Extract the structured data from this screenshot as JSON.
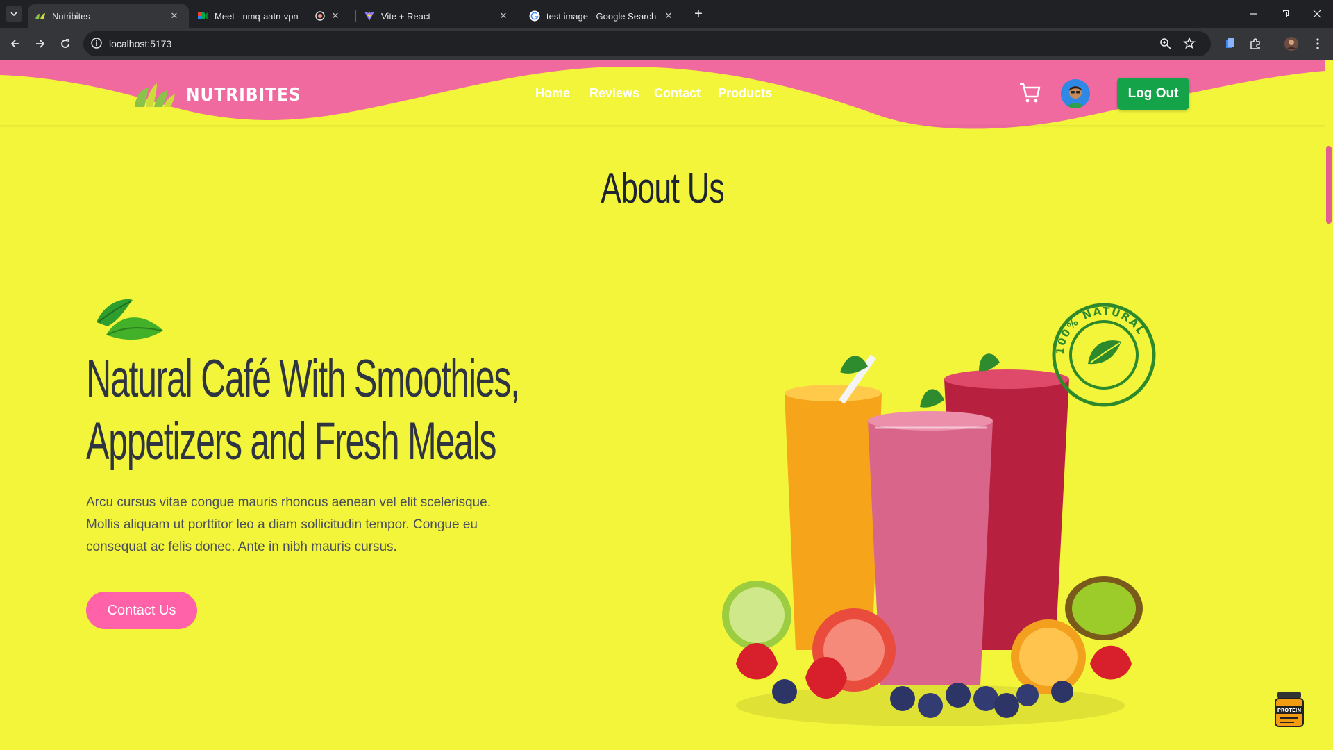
{
  "browser": {
    "tabs": [
      {
        "title": "Nutribites",
        "active": true
      },
      {
        "title": "Meet - nmq-aatn-vpn",
        "active": false
      },
      {
        "title": "Vite + React",
        "active": false
      },
      {
        "title": "test image - Google Search",
        "active": false
      }
    ],
    "url": "localhost:5173"
  },
  "nav": {
    "logo_text": "NUTRIBITES",
    "links": [
      "Home",
      "Reviews",
      "Contact",
      "Products"
    ],
    "logout_label": "Log Out"
  },
  "about": {
    "section_title": "About Us",
    "headline_line1": "Natural Café With Smoothies,",
    "headline_line2": "Appetizers and Fresh Meals",
    "paragraph": "Arcu cursus vitae congue mauris rhoncus aenean vel elit scelerisque. Mollis aliquam ut porttitor leo a diam sollicitudin tempor. Congue eu consequat ac felis donec. Ante in nibh mauris cursus.",
    "contact_label": "Contact Us",
    "stamp_text": "100% NATURAL"
  },
  "widgets": {
    "protein_label": "PROTEIN"
  },
  "colors": {
    "page_bg": "#f2f53a",
    "wave_pink": "#f06aa0",
    "logout_green": "#15a34a",
    "contact_pink": "#ff62a8",
    "heading_dark": "#2f3441"
  }
}
